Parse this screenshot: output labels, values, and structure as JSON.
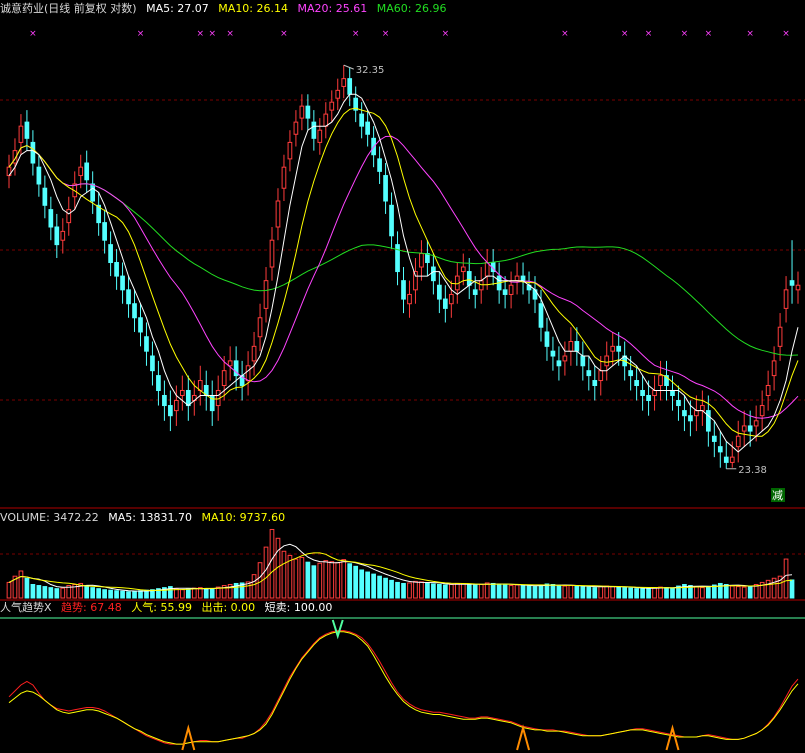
{
  "colors": {
    "up": "#ff3c3c",
    "down": "#54ffff",
    "ma5": "#ffffff",
    "ma10": "#ffff00",
    "ma20": "#ff44ff",
    "ma60": "#22dd22",
    "grid": "#7a0000",
    "label": "#c0c0c0",
    "trend": "#ff2020",
    "pop": "#ffff00",
    "out": "#ffff00",
    "short": "#ffffff"
  },
  "price_panel": {
    "title": "诚意药业(日线 前复权 对数)",
    "ma5_label": "MA5: 27.07",
    "ma10_label": "MA10: 26.14",
    "ma20_label": "MA20: 25.61",
    "ma60_label": "MA60: 26.96",
    "high_label": "32.35",
    "low_label": "23.38",
    "reduce_label": "减"
  },
  "volume_panel": {
    "vol_label": "VOLUME: 3472.22",
    "ma5_label": "MA5: 13831.70",
    "ma10_label": "MA10: 9737.60"
  },
  "indicator_panel": {
    "title": "人气趋势X",
    "trend_label": "趋势: 67.48",
    "pop_label": "人气: 55.99",
    "out_label": "出击: 0.00",
    "short_label": "短卖: 100.00"
  },
  "chart_data": [
    {
      "type": "candlestick",
      "title": "诚意药业(日线 前复权 对数)",
      "ylim": [
        22.8,
        33.6
      ],
      "x": [
        0,
        1,
        2,
        3,
        4,
        5,
        6,
        7,
        8,
        9,
        10,
        11,
        12,
        13,
        14,
        15,
        16,
        17,
        18,
        19,
        20,
        21,
        22,
        23,
        24,
        25,
        26,
        27,
        28,
        29,
        30,
        31,
        32,
        33,
        34,
        35,
        36,
        37,
        38,
        39,
        40,
        41,
        42,
        43,
        44,
        45,
        46,
        47,
        48,
        49,
        50,
        51,
        52,
        53,
        54,
        55,
        56,
        57,
        58,
        59,
        60,
        61,
        62,
        63,
        64,
        65,
        66,
        67,
        68,
        69,
        70,
        71,
        72,
        73,
        74,
        75,
        76,
        77,
        78,
        79,
        80,
        81,
        82,
        83,
        84,
        85,
        86,
        87,
        88,
        89,
        90,
        91,
        92,
        93,
        94,
        95,
        96,
        97,
        98,
        99,
        100,
        101,
        102,
        103,
        104,
        105,
        106,
        107,
        108,
        109,
        110,
        111,
        112,
        113,
        114,
        115,
        116,
        117,
        118,
        119,
        120,
        121,
        122,
        123,
        124,
        125,
        126,
        127,
        128,
        129,
        130,
        131,
        132
      ],
      "close": [
        29.8,
        30.2,
        30.8,
        30.5,
        29.9,
        29.4,
        28.9,
        28.4,
        28.0,
        28.3,
        28.8,
        29.4,
        29.8,
        29.5,
        29.0,
        28.5,
        28.1,
        27.6,
        27.3,
        27.0,
        26.7,
        26.4,
        26.1,
        25.7,
        25.3,
        24.9,
        24.6,
        24.4,
        24.7,
        24.9,
        24.6,
        24.8,
        25.1,
        24.8,
        24.5,
        24.9,
        25.3,
        25.5,
        25.2,
        25.0,
        25.4,
        25.8,
        26.4,
        27.2,
        28.1,
        29.0,
        29.8,
        30.4,
        30.9,
        31.3,
        31.0,
        30.5,
        30.7,
        31.1,
        31.4,
        31.7,
        32.0,
        31.6,
        31.2,
        30.8,
        30.6,
        30.1,
        29.7,
        29.0,
        28.2,
        27.4,
        26.8,
        26.9,
        27.4,
        27.8,
        27.6,
        27.2,
        26.8,
        26.6,
        26.9,
        27.3,
        27.5,
        27.1,
        26.9,
        27.2,
        27.6,
        27.4,
        27.0,
        26.9,
        27.1,
        27.3,
        27.2,
        27.0,
        26.8,
        26.2,
        25.8,
        25.6,
        25.4,
        25.6,
        25.9,
        25.7,
        25.4,
        25.2,
        25.0,
        25.3,
        25.6,
        25.8,
        25.7,
        25.4,
        25.2,
        25.0,
        24.8,
        24.7,
        24.9,
        25.2,
        25.0,
        24.8,
        24.6,
        24.4,
        24.3,
        24.5,
        24.6,
        24.1,
        23.9,
        23.7,
        23.5,
        23.6,
        24.0,
        24.2,
        24.1,
        24.3,
        24.6,
        25.0,
        25.5,
        26.2,
        27.0,
        27.1,
        27.1
      ],
      "open": [
        29.6,
        29.9,
        30.4,
        30.9,
        30.4,
        29.8,
        29.3,
        28.8,
        28.4,
        28.1,
        28.5,
        29.1,
        29.6,
        29.9,
        29.4,
        28.9,
        28.5,
        28.0,
        27.6,
        27.3,
        27.0,
        26.7,
        26.4,
        26.0,
        25.6,
        25.2,
        24.8,
        24.6,
        24.5,
        24.8,
        24.9,
        24.7,
        24.9,
        25.0,
        24.8,
        24.6,
        25.0,
        25.4,
        25.5,
        25.2,
        25.1,
        25.5,
        26.0,
        26.6,
        27.5,
        28.4,
        29.3,
        30.0,
        30.6,
        31.0,
        31.3,
        30.9,
        30.4,
        30.8,
        31.2,
        31.5,
        31.8,
        32.0,
        31.5,
        31.1,
        30.9,
        30.5,
        30.0,
        29.6,
        28.9,
        28.0,
        27.2,
        26.7,
        27.0,
        27.5,
        27.8,
        27.5,
        27.1,
        26.8,
        26.7,
        27.0,
        27.4,
        27.4,
        27.0,
        27.0,
        27.3,
        27.6,
        27.3,
        27.0,
        26.9,
        27.2,
        27.3,
        27.1,
        27.0,
        26.7,
        26.1,
        25.7,
        25.5,
        25.5,
        25.7,
        25.9,
        25.6,
        25.3,
        25.1,
        25.1,
        25.4,
        25.7,
        25.8,
        25.6,
        25.3,
        25.1,
        24.9,
        24.8,
        24.8,
        25.0,
        25.2,
        24.9,
        24.7,
        24.5,
        24.4,
        24.4,
        24.5,
        24.5,
        24.0,
        23.8,
        23.6,
        23.5,
        23.8,
        24.1,
        24.2,
        24.2,
        24.4,
        24.8,
        25.2,
        25.8,
        26.6,
        27.2,
        27.0
      ],
      "high": [
        30.1,
        30.5,
        31.1,
        31.2,
        30.7,
        30.1,
        29.6,
        29.1,
        28.7,
        28.6,
        29.1,
        29.7,
        30.1,
        30.2,
        29.7,
        29.2,
        28.8,
        28.3,
        27.9,
        27.6,
        27.3,
        27.0,
        26.7,
        26.3,
        25.9,
        25.5,
        25.1,
        24.9,
        25.0,
        25.2,
        25.2,
        25.1,
        25.4,
        25.3,
        25.1,
        25.2,
        25.6,
        25.8,
        25.8,
        25.5,
        25.7,
        26.1,
        26.7,
        27.5,
        28.4,
        29.3,
        30.1,
        30.7,
        31.2,
        31.6,
        31.6,
        31.2,
        31.0,
        31.4,
        31.7,
        32.0,
        32.35,
        32.3,
        31.8,
        31.4,
        31.2,
        30.8,
        30.3,
        29.9,
        29.2,
        28.3,
        27.5,
        27.2,
        27.7,
        28.1,
        28.1,
        27.8,
        27.4,
        27.1,
        27.2,
        27.6,
        27.8,
        27.7,
        27.3,
        27.5,
        27.9,
        27.9,
        27.6,
        27.3,
        27.4,
        27.6,
        27.6,
        27.4,
        27.3,
        27.0,
        26.4,
        26.0,
        25.8,
        25.9,
        26.2,
        26.2,
        25.9,
        25.6,
        25.4,
        25.6,
        25.9,
        26.1,
        26.1,
        25.9,
        25.6,
        25.4,
        25.2,
        25.1,
        25.2,
        25.5,
        25.5,
        25.2,
        25.0,
        24.8,
        24.7,
        24.8,
        24.9,
        24.8,
        24.3,
        24.1,
        23.9,
        23.9,
        24.3,
        24.5,
        24.5,
        24.6,
        24.9,
        25.3,
        25.8,
        26.5,
        27.3,
        28.1,
        27.4
      ],
      "low": [
        29.3,
        29.6,
        30.1,
        30.2,
        29.6,
        29.1,
        28.6,
        28.1,
        27.7,
        27.8,
        28.2,
        28.8,
        29.3,
        29.2,
        28.7,
        28.2,
        27.8,
        27.3,
        27.0,
        26.7,
        26.4,
        26.1,
        25.8,
        25.4,
        25.0,
        24.6,
        24.3,
        24.1,
        24.2,
        24.5,
        24.3,
        24.4,
        24.6,
        24.5,
        24.2,
        24.3,
        24.7,
        25.1,
        24.9,
        24.7,
        24.8,
        25.2,
        25.7,
        26.3,
        27.2,
        28.1,
        29.0,
        29.7,
        30.3,
        30.7,
        30.7,
        30.2,
        30.1,
        30.5,
        30.9,
        31.2,
        31.5,
        31.3,
        30.9,
        30.5,
        30.3,
        29.8,
        29.4,
        28.7,
        27.9,
        27.1,
        26.5,
        26.4,
        26.7,
        27.2,
        27.3,
        26.9,
        26.5,
        26.3,
        26.4,
        26.7,
        27.1,
        26.8,
        26.6,
        26.7,
        27.0,
        27.1,
        26.7,
        26.6,
        26.6,
        26.9,
        26.9,
        26.7,
        26.5,
        25.9,
        25.5,
        25.3,
        25.1,
        25.2,
        25.4,
        25.4,
        25.1,
        24.9,
        24.7,
        24.8,
        25.1,
        25.4,
        25.4,
        25.1,
        24.9,
        24.7,
        24.5,
        24.4,
        24.5,
        24.7,
        24.7,
        24.5,
        24.3,
        24.1,
        24.0,
        24.1,
        24.2,
        23.8,
        23.6,
        23.4,
        23.38,
        23.4,
        23.5,
        23.8,
        23.8,
        23.9,
        24.1,
        24.5,
        24.9,
        25.5,
        26.3,
        26.7,
        26.7
      ],
      "ma5": [
        29.6,
        29.8,
        30.1,
        30.2,
        30.2,
        30.1,
        29.8,
        29.5,
        29.1,
        28.8,
        28.7,
        28.8,
        29.1,
        29.2,
        29.3,
        29.2,
        28.9,
        28.5,
        28.1,
        27.7,
        27.3,
        27.0,
        26.7,
        26.4,
        26.0,
        25.7,
        25.3,
        25.0,
        24.8,
        24.7,
        24.6,
        24.7,
        24.8,
        24.8,
        24.8,
        24.8,
        24.9,
        25.0,
        25.1,
        25.2,
        25.3,
        25.4,
        25.6,
        26.0,
        26.6,
        27.3,
        28.1,
        28.9,
        29.6,
        30.3,
        30.7,
        30.8,
        30.8,
        30.8,
        30.9,
        31.1,
        31.4,
        31.6,
        31.6,
        31.5,
        31.2,
        30.9,
        30.5,
        30.0,
        29.5,
        28.9,
        28.2,
        27.7,
        27.3,
        27.3,
        27.3,
        27.4,
        27.4,
        27.2,
        27.0,
        26.9,
        27.0,
        27.1,
        27.2,
        27.2,
        27.3,
        27.3,
        27.2,
        27.2,
        27.2,
        27.2,
        27.2,
        27.1,
        27.0,
        26.8,
        26.5,
        26.2,
        25.9,
        25.7,
        25.7,
        25.7,
        25.6,
        25.6,
        25.4,
        25.3,
        25.3,
        25.4,
        25.5,
        25.6,
        25.5,
        25.4,
        25.2,
        25.0,
        24.9,
        24.9,
        24.9,
        24.9,
        24.9,
        24.8,
        24.6,
        24.5,
        24.5,
        24.4,
        24.3,
        24.1,
        23.9,
        23.8,
        23.7,
        23.8,
        23.9,
        24.0,
        24.1,
        24.2,
        24.4,
        24.7,
        25.1,
        25.7,
        26.2
      ]
    },
    {
      "type": "bar",
      "title": "VOLUME",
      "values": [
        3000,
        4200,
        5200,
        3800,
        2600,
        2400,
        2200,
        2000,
        1800,
        1900,
        2400,
        2600,
        2800,
        2400,
        2000,
        1800,
        1600,
        1500,
        1400,
        1300,
        1200,
        1300,
        1400,
        1500,
        1600,
        1800,
        2000,
        2200,
        1800,
        1600,
        1700,
        1900,
        2000,
        1800,
        1700,
        2100,
        2400,
        2600,
        2800,
        2900,
        3100,
        4500,
        6800,
        9800,
        13200,
        11500,
        9000,
        8200,
        7500,
        7800,
        6900,
        6200,
        6700,
        7200,
        7000,
        6800,
        7400,
        6600,
        6100,
        5400,
        5000,
        4600,
        4200,
        3800,
        3400,
        3000,
        2800,
        2900,
        3200,
        3100,
        2900,
        2700,
        2600,
        2500,
        2600,
        2800,
        2700,
        2600,
        2500,
        2600,
        2900,
        2800,
        2700,
        2500,
        2400,
        2500,
        2400,
        2300,
        2200,
        2500,
        2700,
        2600,
        2400,
        2300,
        2400,
        2300,
        2200,
        2100,
        2000,
        2200,
        2300,
        2200,
        2100,
        2000,
        1900,
        1800,
        1800,
        1900,
        2000,
        2100,
        2000,
        1900,
        2300,
        2600,
        2400,
        2200,
        2000,
        2100,
        2500,
        2800,
        2600,
        2300,
        2200,
        2100,
        2300,
        2600,
        3000,
        3400,
        3800,
        4200,
        7500,
        3472.22
      ]
    },
    {
      "type": "line",
      "title": "人气趋势X",
      "ylim": [
        0,
        110
      ],
      "series": [
        {
          "name": "趋势",
          "values": [
            45,
            50,
            55,
            58,
            55,
            48,
            42,
            38,
            35,
            34,
            33,
            34,
            35,
            36,
            36,
            35,
            33,
            30,
            27,
            24,
            21,
            18,
            15,
            12,
            10,
            8,
            6,
            5,
            5,
            5,
            6,
            7,
            8,
            8,
            7,
            7,
            8,
            9,
            10,
            10,
            12,
            14,
            18,
            24,
            32,
            42,
            52,
            62,
            70,
            78,
            84,
            90,
            95,
            98,
            100,
            101,
            101,
            100,
            98,
            95,
            90,
            83,
            75,
            66,
            57,
            49,
            43,
            39,
            36,
            34,
            33,
            32,
            32,
            31,
            30,
            29,
            28,
            27,
            27,
            28,
            28,
            27,
            26,
            25,
            24,
            22,
            20,
            19,
            18,
            17,
            17,
            17,
            16,
            16,
            15,
            14,
            13,
            12,
            12,
            12,
            13,
            14,
            15,
            16,
            17,
            18,
            18,
            17,
            16,
            15,
            14,
            13,
            12,
            11,
            11,
            11,
            12,
            13,
            12,
            11,
            10,
            9,
            9,
            10,
            12,
            14,
            17,
            22,
            28,
            36,
            45,
            54,
            60
          ]
        },
        {
          "name": "人气",
          "values": [
            40,
            44,
            48,
            50,
            49,
            46,
            42,
            38,
            34,
            32,
            31,
            32,
            33,
            34,
            34,
            33,
            31,
            29,
            27,
            24,
            21,
            18,
            16,
            13,
            11,
            9,
            7,
            6,
            5,
            5,
            6,
            7,
            7,
            7,
            7,
            7,
            8,
            9,
            10,
            11,
            12,
            14,
            17,
            22,
            30,
            40,
            50,
            60,
            69,
            77,
            83,
            89,
            94,
            97,
            99,
            100,
            100,
            99,
            97,
            93,
            88,
            80,
            71,
            62,
            54,
            47,
            41,
            37,
            34,
            32,
            31,
            30,
            30,
            29,
            28,
            27,
            26,
            26,
            26,
            27,
            27,
            26,
            25,
            24,
            23,
            21,
            19,
            18,
            17,
            17,
            16,
            16,
            16,
            15,
            14,
            13,
            12,
            12,
            12,
            12,
            13,
            14,
            15,
            16,
            17,
            17,
            17,
            16,
            15,
            14,
            13,
            12,
            11,
            11,
            11,
            11,
            12,
            12,
            11,
            10,
            9,
            9,
            9,
            10,
            12,
            14,
            17,
            21,
            27,
            34,
            42,
            50,
            56
          ]
        }
      ]
    }
  ]
}
